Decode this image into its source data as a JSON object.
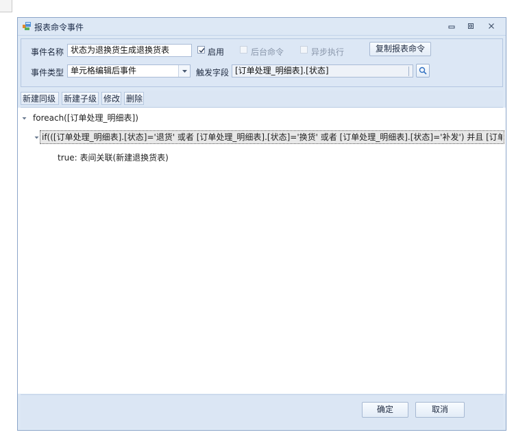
{
  "window": {
    "title": "报表命令事件"
  },
  "form": {
    "event_name_label": "事件名称",
    "event_name_value": "状态为退换货生成退换货表",
    "enable_label": "启用",
    "enable_checked": true,
    "background_label": "后台命令",
    "background_checked": false,
    "async_label": "异步执行",
    "async_checked": false,
    "copy_button": "复制报表命令",
    "event_type_label": "事件类型",
    "event_type_value": "单元格编辑后事件",
    "trigger_field_label": "触发字段",
    "trigger_field_value": "[订单处理_明细表].[状态]"
  },
  "toolbar": {
    "new_sibling": "新建同级",
    "new_child": "新建子级",
    "edit": "修改",
    "delete": "删除"
  },
  "tree": {
    "root": "foreach([订单处理_明细表])",
    "condition": "if(([订单处理_明细表].[状态]='退货' 或者 [订单处理_明细表].[状态]='换货' 或者 [订单处理_明细表].[状态]='补发') 并且 [订单...",
    "true_branch": "true: 表间关联(新建退换货表)"
  },
  "footer": {
    "ok": "确定",
    "cancel": "取消"
  },
  "colors": {
    "window_bg": "#dde8f5",
    "border": "#8aa4c8",
    "selected_row": "#e8e8e8"
  }
}
